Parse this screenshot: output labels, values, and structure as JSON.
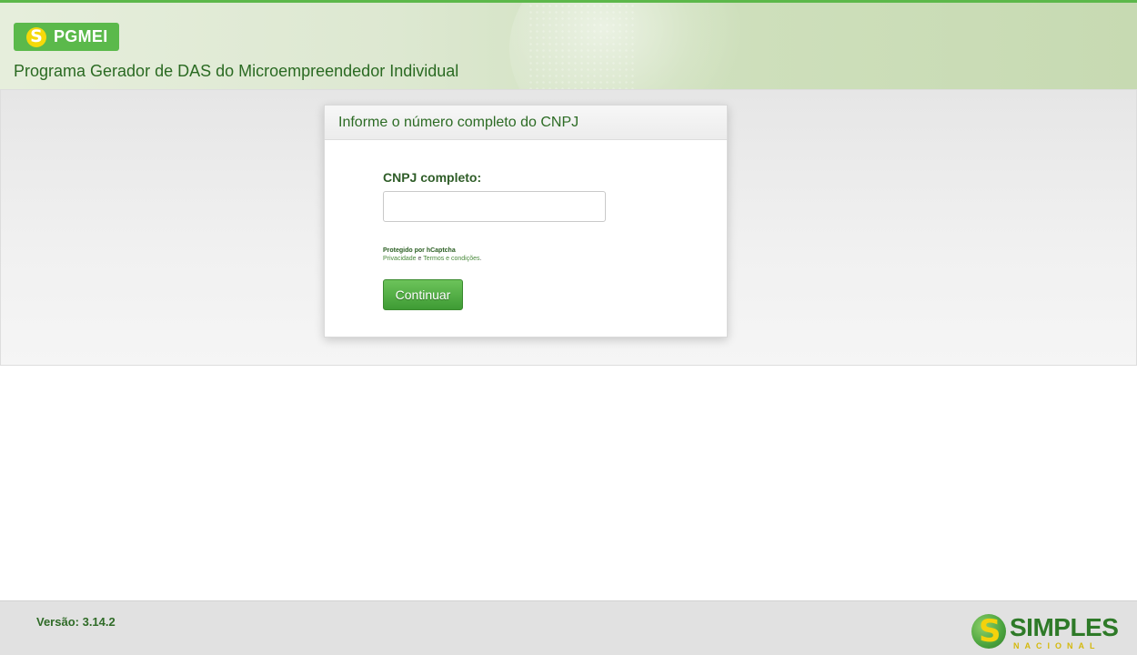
{
  "header": {
    "logo_text": "PGMEI",
    "subtitle": "Programa Gerador de DAS do Microempreendedor Individual"
  },
  "card": {
    "title": "Informe o número completo do CNPJ",
    "field_label": "CNPJ completo:",
    "input_value": "",
    "captcha": {
      "title": "Protegido por hCaptcha",
      "privacy": "Privacidade",
      "and": "e",
      "terms": "Termos e condições",
      "period": "."
    },
    "continue_label": "Continuar"
  },
  "footer": {
    "version": "Versão: 3.14.2",
    "brand": "SIMPLES",
    "brand_sub": "NACIONAL"
  },
  "colors": {
    "brand_green": "#5bb94b",
    "text_green": "#2c6b24",
    "brand_yellow": "#f5d90a"
  }
}
